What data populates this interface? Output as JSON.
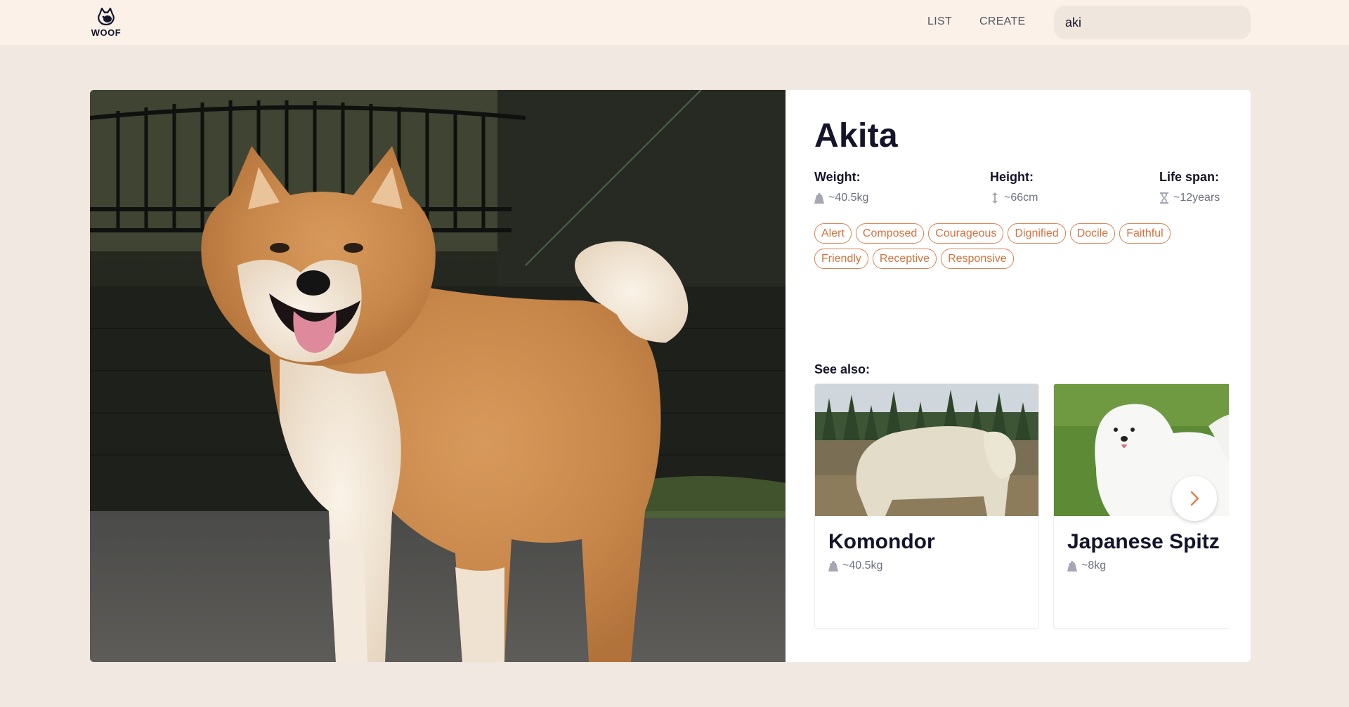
{
  "header": {
    "logo_text": "WOOF",
    "nav": {
      "list_label": "LIST",
      "create_label": "CREATE"
    },
    "search": {
      "value": "aki"
    }
  },
  "breed": {
    "name": "Akita",
    "weight": {
      "label": "Weight:",
      "value": "~40.5kg",
      "icon": "weight-icon"
    },
    "height": {
      "label": "Height:",
      "value": "~66cm",
      "icon": "height-arrow-icon"
    },
    "life_span": {
      "label": "Life span:",
      "value": "~12years",
      "icon": "hourglass-icon"
    },
    "temperament": [
      "Alert",
      "Composed",
      "Courageous",
      "Dignified",
      "Docile",
      "Faithful",
      "Friendly",
      "Receptive",
      "Responsive"
    ]
  },
  "see_also": {
    "label": "See also:",
    "items": [
      {
        "name": "Komondor",
        "weight": "~40.5kg"
      },
      {
        "name": "Japanese Spitz",
        "weight": "~8kg"
      }
    ],
    "next_icon": "chevron-right-icon"
  },
  "colors": {
    "page_bg": "#f0e8e1",
    "header_bg": "#fbf1e8",
    "accent": "#d98452",
    "text_dark": "#14142b",
    "text_muted": "#6e7081"
  }
}
